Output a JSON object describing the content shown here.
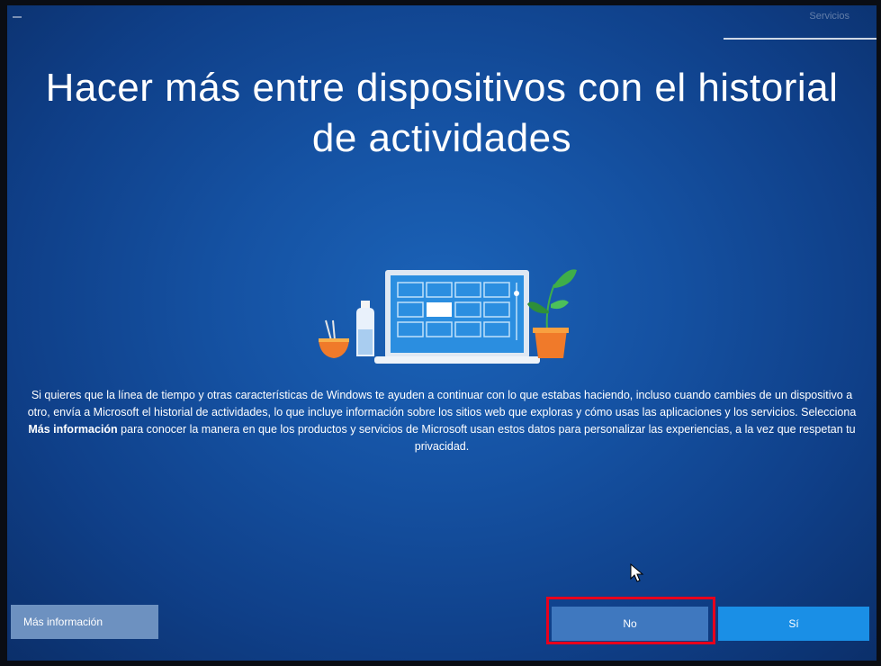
{
  "header": {
    "progress_label": "Servicios"
  },
  "page": {
    "title": "Hacer más entre dispositivos con el historial de actividades"
  },
  "description": {
    "part1": "Si quieres que la línea de tiempo y otras características de Windows te ayuden a continuar con lo que estabas haciendo, incluso cuando cambies de un dispositivo a otro, envía a Microsoft el historial de actividades, lo que incluye información sobre los sitios web que exploras y cómo usas las aplicaciones y los servicios. Selecciona ",
    "bold": "Más información",
    "part2": " para conocer la manera en que los productos y servicios de Microsoft usan estos datos para personalizar las experiencias, a la vez que respetan tu privacidad."
  },
  "buttons": {
    "more_info": "Más información",
    "no": "No",
    "yes": "Sí"
  },
  "colors": {
    "background": "#1552a3",
    "highlight": "#e8001c",
    "yes_button": "#1a8fe6",
    "more_info_button": "#6d91c0"
  },
  "icons": {
    "illustration": "laptop-plant-bottle-bowl-illustration",
    "cursor": "mouse-pointer-icon"
  }
}
